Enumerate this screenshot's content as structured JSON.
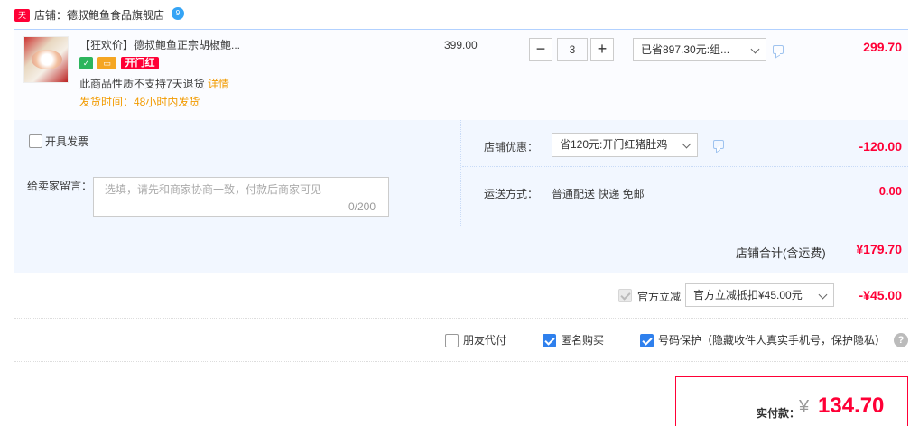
{
  "shop": {
    "badge": "天猫",
    "label": "店铺：德叔鲍鱼食品旗舰店",
    "ww_icon_text": "9"
  },
  "item": {
    "title": "【狂欢价】德叔鲍鱼正宗胡椒鲍...",
    "tags": [
      "✓",
      "▭",
      "开门红"
    ],
    "no_return": "此商品性质不支持7天退货",
    "detail_link": "详情",
    "ship_time": "发货时间：48小时内发货",
    "price": "399.00",
    "qty_minus": "−",
    "qty": "3",
    "qty_plus": "+",
    "discount_option": "已省897.30元:组...",
    "subtotal": "299.70"
  },
  "options": {
    "invoice_label": "开具发票",
    "memo_label": "给卖家留言：",
    "memo_placeholder": "选填，请先和商家协商一致，付款后商家可见",
    "memo_count": "0/200",
    "shop_discount_label": "店铺优惠：",
    "shop_discount_option": "省120元:开门红猪肚鸡",
    "shop_discount_value": "-120.00",
    "shipping_label": "运送方式：",
    "shipping_method": "普通配送 快递 免邮",
    "shipping_value": "0.00",
    "shop_total_label": "店铺合计(含运费)",
    "shop_total_value": "¥179.70"
  },
  "official": {
    "label": "官方立减",
    "option": "官方立减抵扣¥45.00元",
    "value": "-¥45.00"
  },
  "extras": {
    "friend_pay": "朋友代付",
    "anonymous": "匿名购买",
    "phone_protect": "号码保护（隐藏收件人真实手机号，保护隐私）",
    "help": "?"
  },
  "payment": {
    "label": "实付款：",
    "currency": "¥",
    "amount": "134.70"
  },
  "colors": {
    "accent": "#ff0036",
    "link": "#f29b00",
    "check": "#2f80ed"
  }
}
